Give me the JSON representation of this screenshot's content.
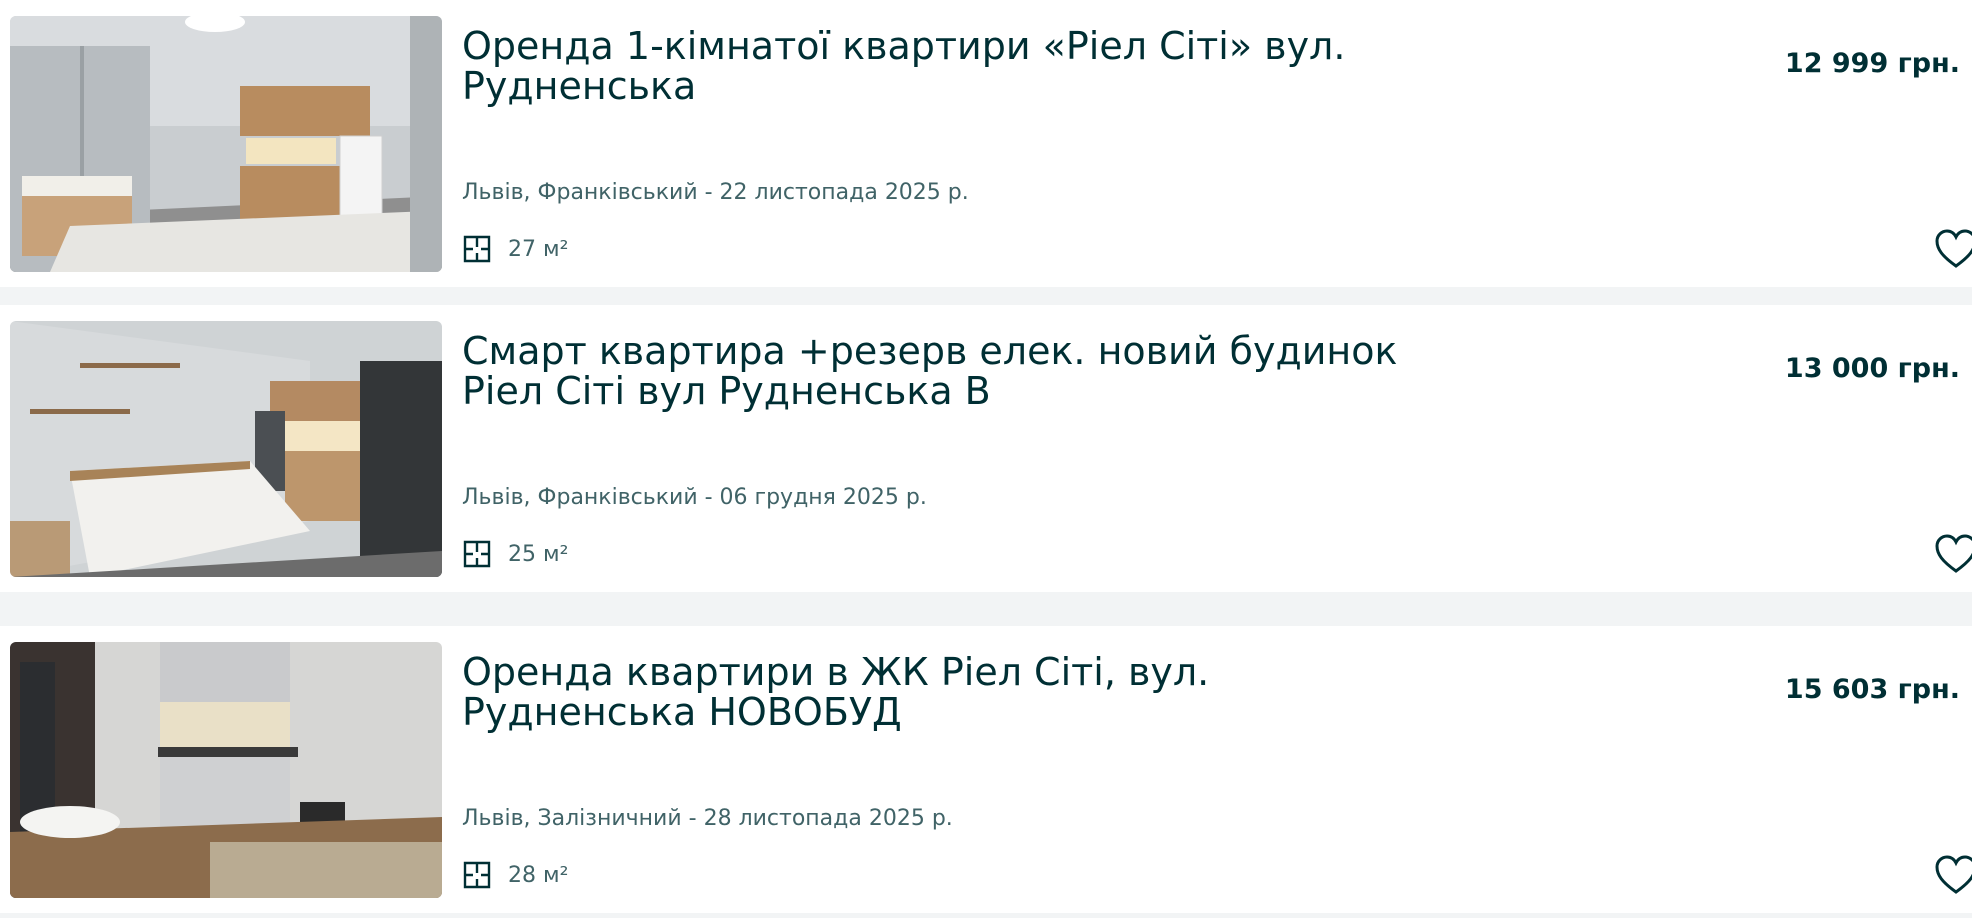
{
  "listings": [
    {
      "title": "Оренда 1-кімнатої квартири «Ріел Сіті» вул. Рудненська",
      "price": "12 999 грн.",
      "location_date": "Львів, Франківський - 22 листопада 2025 р.",
      "area": "27 м²",
      "area_icon": "floor-plan-icon",
      "favorite_icon": "heart-outline-icon"
    },
    {
      "title": "Смарт квартира +резерв елек. новий будинок Ріел Сіті вул Рудненська В",
      "price": "13 000 грн.",
      "location_date": "Львів, Франківський - 06 грудня 2025 р.",
      "area": "25 м²",
      "area_icon": "floor-plan-icon",
      "favorite_icon": "heart-outline-icon"
    },
    {
      "title": "Оренда квартири в ЖК Ріел Сіті, вул. Рудненська НОВОБУД",
      "price": "15 603 грн.",
      "location_date": "Львів, Залізничний - 28 листопада 2025 р.",
      "area": "28 м²",
      "area_icon": "floor-plan-icon",
      "favorite_icon": "heart-outline-icon"
    }
  ],
  "colors": {
    "text_primary": "#002f34",
    "text_secondary": "#406367",
    "page_background": "#f2f4f5",
    "card_background": "#ffffff"
  }
}
